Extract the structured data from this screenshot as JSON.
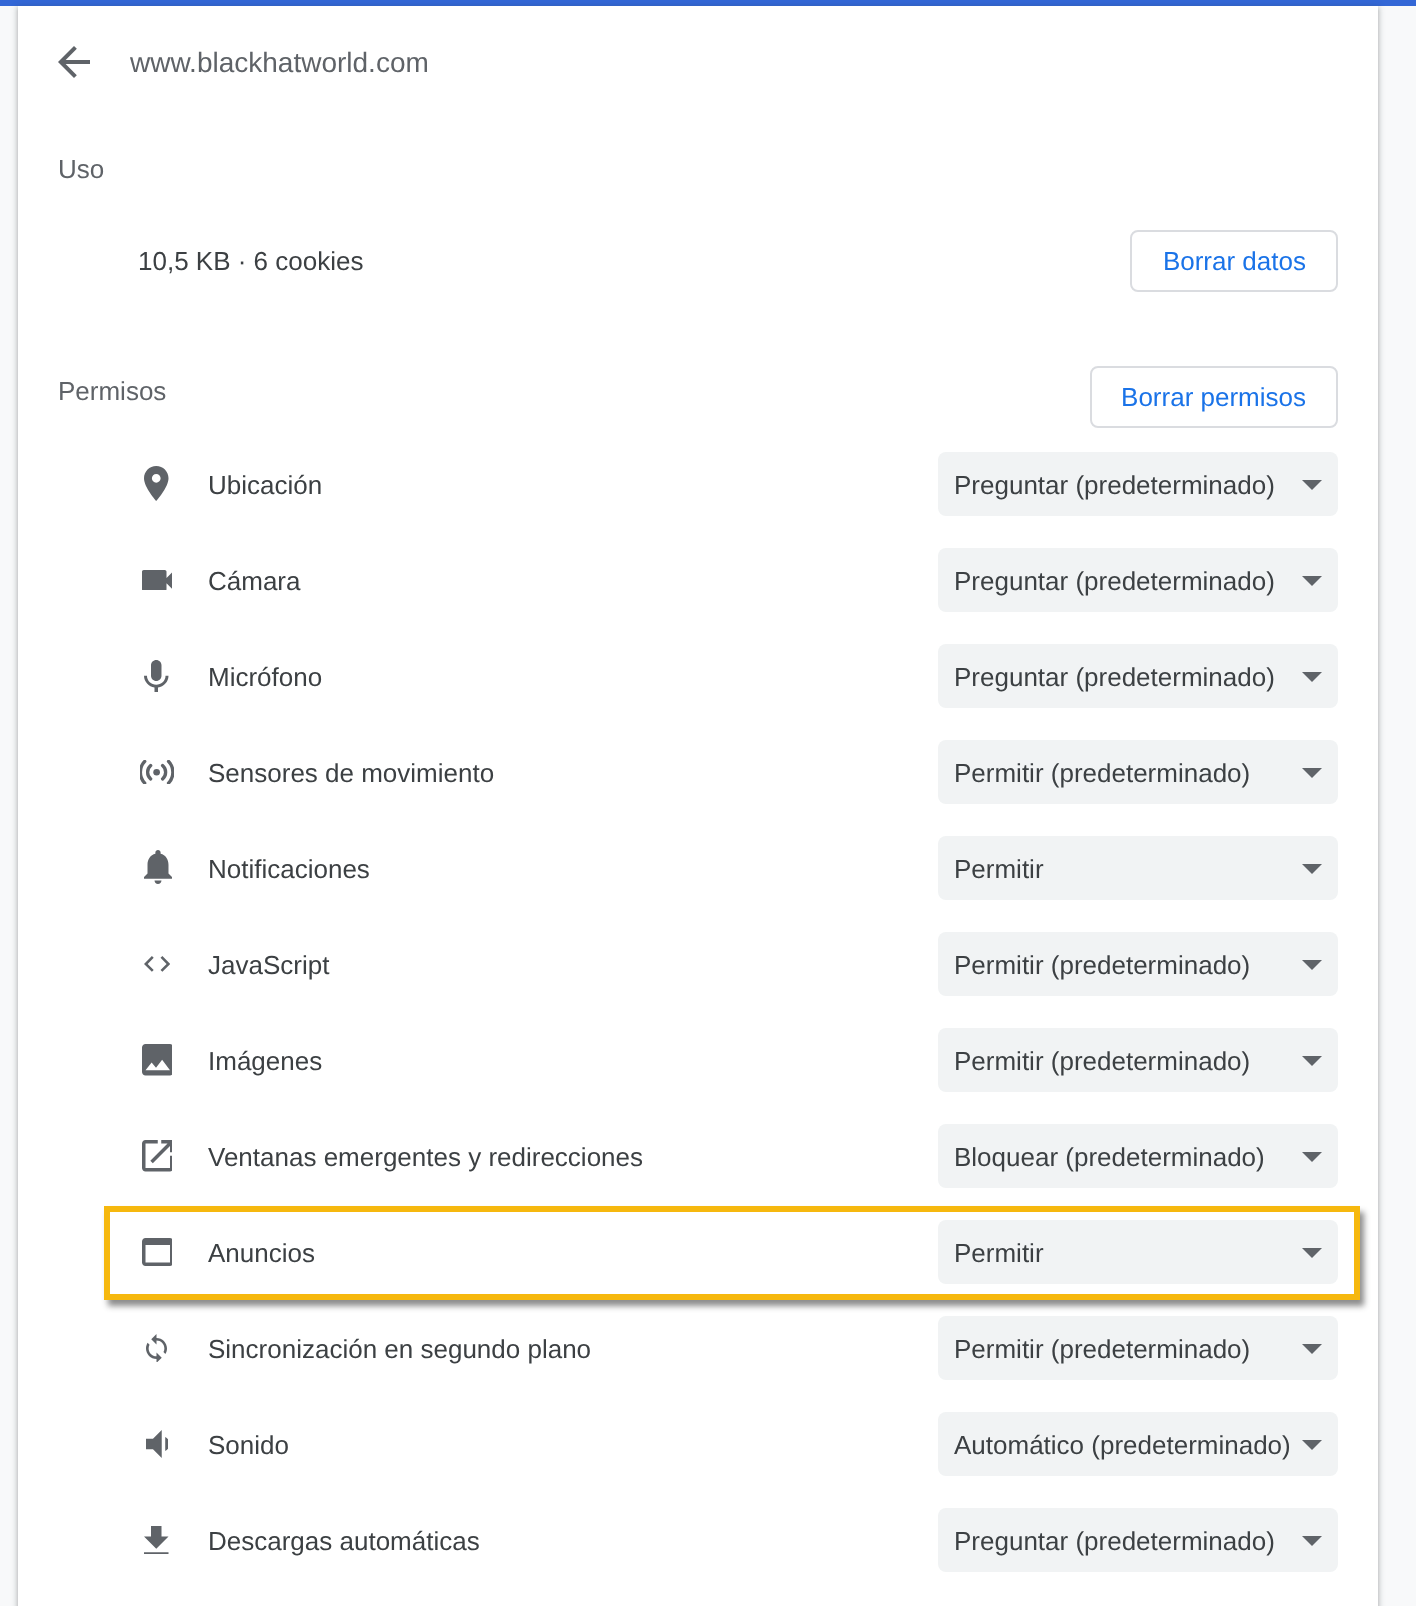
{
  "header": {
    "title": "www.blackhatworld.com"
  },
  "usage": {
    "heading": "Uso",
    "summary": "10,5 KB · 6 cookies",
    "clear_button": "Borrar datos"
  },
  "permissions": {
    "heading": "Permisos",
    "reset_button": "Borrar permisos",
    "items": [
      {
        "label": "Ubicación",
        "value": "Preguntar (predeterminado)",
        "highlighted": false
      },
      {
        "label": "Cámara",
        "value": "Preguntar (predeterminado)",
        "highlighted": false
      },
      {
        "label": "Micrófono",
        "value": "Preguntar (predeterminado)",
        "highlighted": false
      },
      {
        "label": "Sensores de movimiento",
        "value": "Permitir (predeterminado)",
        "highlighted": false
      },
      {
        "label": "Notificaciones",
        "value": "Permitir",
        "highlighted": false
      },
      {
        "label": "JavaScript",
        "value": "Permitir (predeterminado)",
        "highlighted": false
      },
      {
        "label": "Imágenes",
        "value": "Permitir (predeterminado)",
        "highlighted": false
      },
      {
        "label": "Ventanas emergentes y redirecciones",
        "value": "Bloquear (predeterminado)",
        "highlighted": false
      },
      {
        "label": "Anuncios",
        "value": "Permitir",
        "highlighted": true
      },
      {
        "label": "Sincronización en segundo plano",
        "value": "Permitir (predeterminado)",
        "highlighted": false
      },
      {
        "label": "Sonido",
        "value": "Automático (predeterminado)",
        "highlighted": false
      },
      {
        "label": "Descargas automáticas",
        "value": "Preguntar (predeterminado)",
        "highlighted": false
      }
    ]
  }
}
